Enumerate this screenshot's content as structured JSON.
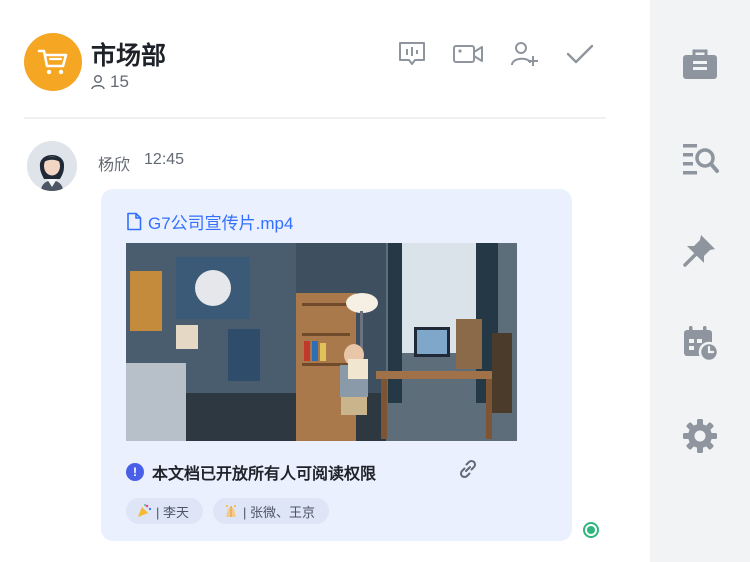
{
  "group": {
    "name": "市场部",
    "member_count": "15"
  },
  "header_actions": [
    "message-board-icon",
    "video-call-icon",
    "add-member-icon",
    "check-icon"
  ],
  "message": {
    "sender": "杨欣",
    "time": "12:45",
    "file_name": "G7公司宣传片.mp4",
    "permission_text": "本文档已开放所有人可阅读权限",
    "shared_with": [
      {
        "label": "| 李天"
      },
      {
        "label": "| 张微、王京"
      }
    ]
  },
  "sidebar": {
    "items": [
      "briefcase-icon",
      "search-history-icon",
      "pin-icon",
      "calendar-clock-icon",
      "gear-icon"
    ]
  },
  "colors": {
    "accent": "#3370ff",
    "group_avatar": "#f5a623",
    "card_bg": "#eaf0fd",
    "rail_bg": "#f2f3f5",
    "read_indicator": "#2eb67d"
  }
}
